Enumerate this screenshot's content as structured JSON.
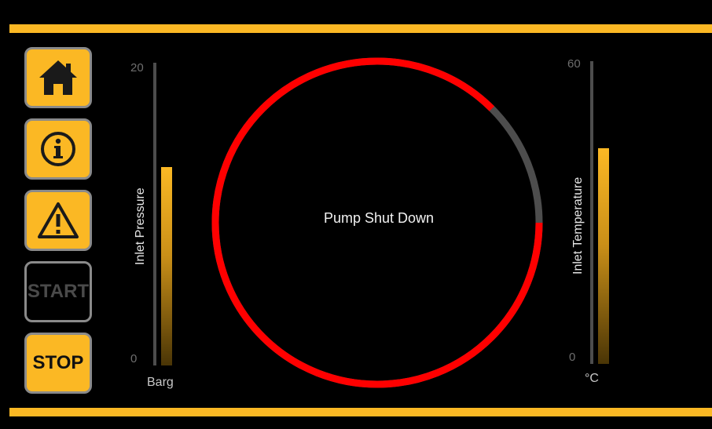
{
  "colors": {
    "accent": "#fbb824",
    "alarm_ring": "#ff0000",
    "ring_track": "#4d4d4d",
    "background": "#000000"
  },
  "nav": {
    "home_icon": "home-icon",
    "info_icon": "info-icon",
    "warning_icon": "warning-icon",
    "start_label": "START",
    "start_enabled": false,
    "stop_label": "STOP"
  },
  "pressure": {
    "title": "Inlet Pressure",
    "max_label": "20",
    "min_label": "0",
    "unit": "Barg",
    "level_fraction": 0.68
  },
  "temperature": {
    "title": "Inlet Temperature",
    "max_label": "60",
    "min_label": "0",
    "unit": "°C",
    "level_fraction": 0.74
  },
  "gauge": {
    "status": "Pump Shut Down",
    "ring_fill_fraction": 0.875
  }
}
